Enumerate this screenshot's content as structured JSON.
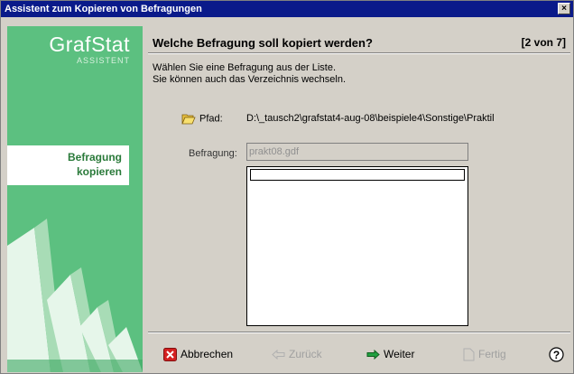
{
  "window": {
    "title": "Assistent zum Kopieren von Befragungen",
    "close_glyph": "×"
  },
  "sidebar": {
    "brand_name": "GrafStat",
    "brand_sub": "ASSISTENT",
    "step_line1": "Befragung",
    "step_line2": "kopieren"
  },
  "header": {
    "title": "Welche Befragung soll kopiert werden?",
    "step": "[2 von 7]"
  },
  "description": {
    "line1": "Wählen Sie eine Befragung aus der Liste.",
    "line2": "Sie können auch das Verzeichnis wechseln."
  },
  "path": {
    "label": "Pfad:",
    "value": "D:\\_tausch2\\grafstat4-aug-08\\beispiele4\\Sonstige\\Praktil",
    "icon": "folder-open-icon"
  },
  "survey": {
    "label": "Befragung:",
    "value": "prakt08.gdf"
  },
  "list": {
    "items": []
  },
  "buttons": {
    "cancel": "Abbrechen",
    "back": "Zurück",
    "next": "Weiter",
    "finish": "Fertig",
    "help_glyph": "?"
  },
  "colors": {
    "title_bar": "#0a1a8a",
    "sidebar_green": "#5cc080",
    "step_text": "#2a7a3a"
  }
}
